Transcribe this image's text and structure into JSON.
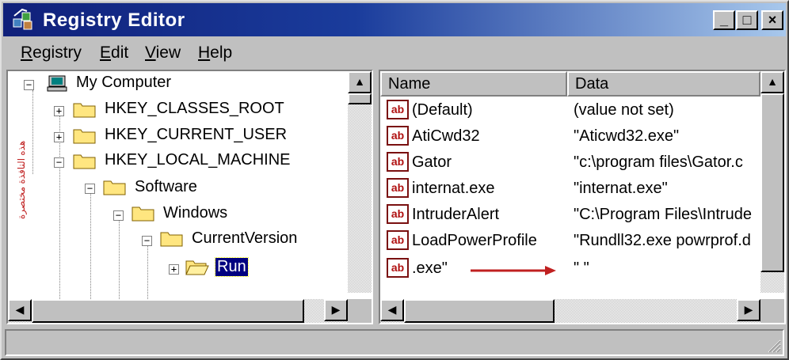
{
  "window": {
    "title": "Registry Editor",
    "controls": {
      "minimize": "_",
      "maximize": "□",
      "close": "×"
    }
  },
  "menu": [
    {
      "label_u": "R",
      "label_rest": "egistry"
    },
    {
      "label_u": "E",
      "label_rest": "dit"
    },
    {
      "label_u": "V",
      "label_rest": "iew"
    },
    {
      "label_u": "H",
      "label_rest": "elp"
    }
  ],
  "tree": {
    "root": "My Computer",
    "hkcr": "HKEY_CLASSES_ROOT",
    "hkcu": "HKEY_CURRENT_USER",
    "hklm": "HKEY_LOCAL_MACHINE",
    "software": "Software",
    "windows": "Windows",
    "currentversion": "CurrentVersion",
    "run": "Run",
    "selected": "Run"
  },
  "annotation": {
    "arabic_note": "هذه النافذة مختصرة",
    "arrow_color": "#c02020"
  },
  "list": {
    "columns": {
      "name": "Name",
      "data": "Data"
    },
    "rows": [
      {
        "name": "(Default)",
        "data": "(value not set)"
      },
      {
        "name": "AtiCwd32",
        "data": "\"Aticwd32.exe\""
      },
      {
        "name": "Gator",
        "data": "\"c:\\program files\\Gator.c"
      },
      {
        "name": "internat.exe",
        "data": "\"internat.exe\""
      },
      {
        "name": "IntruderAlert",
        "data": "\"C:\\Program Files\\Intrude"
      },
      {
        "name": "LoadPowerProfile",
        "data": "\"Rundll32.exe powrprof.d"
      },
      {
        "name": ".exe\"",
        "data": "\" \""
      }
    ],
    "value_icon": "ab"
  },
  "colors": {
    "title_start": "#10207a",
    "title_end": "#a8c8ec",
    "selection": "#000080",
    "face": "#c0c0c0"
  }
}
